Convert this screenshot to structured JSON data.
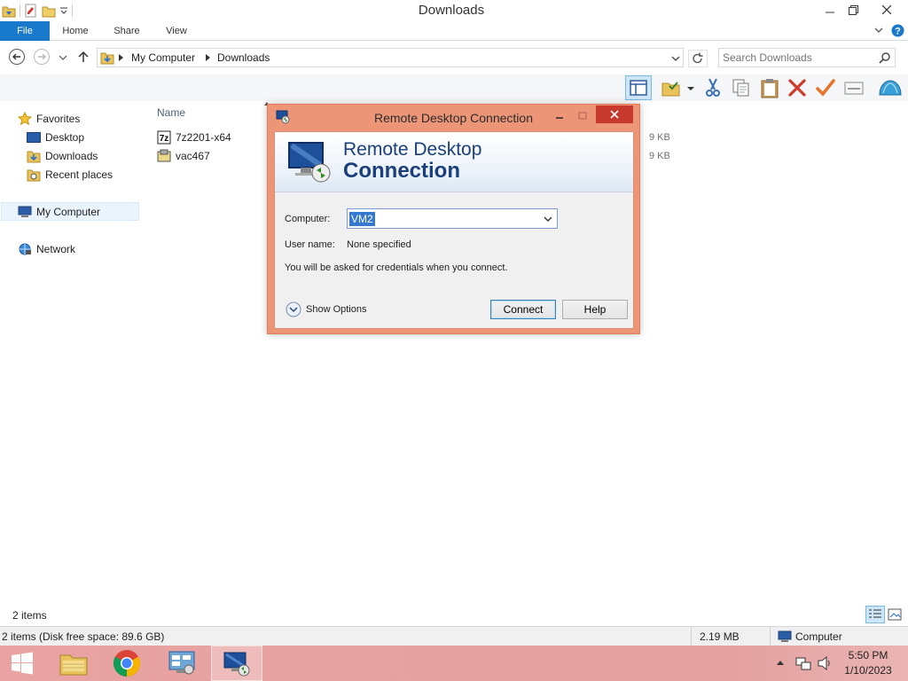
{
  "window": {
    "title": "Downloads"
  },
  "ribbon": {
    "tabs": [
      "File",
      "Home",
      "Share",
      "View"
    ]
  },
  "address": {
    "crumbs": [
      "My Computer",
      "Downloads"
    ]
  },
  "search": {
    "placeholder": "Search Downloads"
  },
  "nav": {
    "favorites_label": "Favorites",
    "favorites": [
      "Desktop",
      "Downloads",
      "Recent places"
    ],
    "computer_label": "My Computer",
    "network_label": "Network"
  },
  "content": {
    "column_name": "Name",
    "files": [
      {
        "name": "7z2201-x64",
        "size_partial": "9 KB"
      },
      {
        "name": "vac467",
        "size_partial": "9 KB"
      }
    ]
  },
  "status": {
    "items_count": "2 items",
    "summary": "2 items (Disk free space: 89.6 GB)",
    "size": "2.19 MB",
    "location": "Computer"
  },
  "taskbar": {
    "time": "5:50 PM",
    "date": "1/10/2023"
  },
  "rdp": {
    "title": "Remote Desktop Connection",
    "banner_line1": "Remote Desktop",
    "banner_line2": "Connection",
    "computer_label": "Computer:",
    "computer_value": "VM2",
    "username_label": "User name:",
    "username_value": "None specified",
    "credentials_note": "You will be asked for credentials when you connect.",
    "show_options": "Show Options",
    "connect_label": "Connect",
    "help_label": "Help"
  },
  "colors": {
    "file_tab": "#1979ca",
    "taskbar": "#e3a09f",
    "dialog_frame": "#ec9577",
    "close_button": "#c7392c"
  }
}
